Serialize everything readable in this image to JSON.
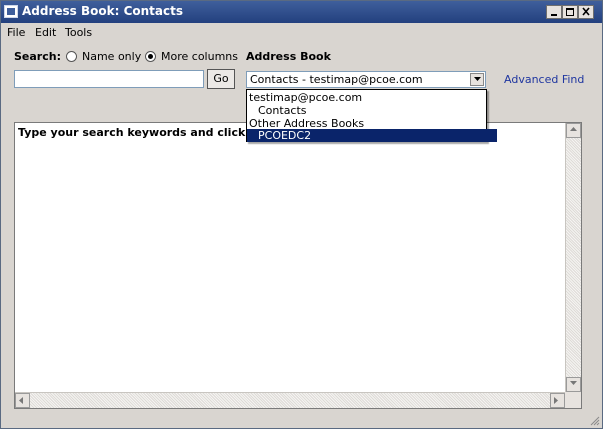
{
  "window": {
    "title": "Address Book: Contacts"
  },
  "menubar": {
    "items": [
      "File",
      "Edit",
      "Tools"
    ]
  },
  "search": {
    "label": "Search:",
    "option_name_only": "Name only",
    "option_more_columns": "More columns",
    "selected_option": "More columns",
    "input_value": "",
    "go_label": "Go"
  },
  "address_book": {
    "label": "Address Book",
    "selected": "Contacts - testimap@pcoe.com",
    "advanced_find": "Advanced Find",
    "dropdown": {
      "items": [
        "testimap@pcoe.com",
        "Contacts",
        "Other Address Books",
        "PCOEDC2"
      ],
      "highlighted": "PCOEDC2"
    }
  },
  "results": {
    "message": "Type your search keywords and click 'Go'."
  },
  "colors": {
    "titlebar": "#2b4a8a",
    "highlight": "#0a246a",
    "link": "#1f36a0"
  }
}
